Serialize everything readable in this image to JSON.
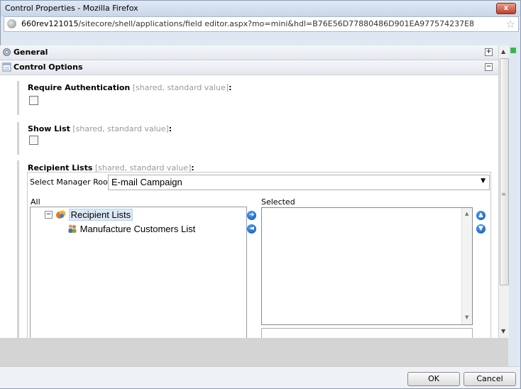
{
  "window": {
    "title": "Control Properties - Mozilla Firefox",
    "close_label": "x"
  },
  "urlbar": {
    "host": "660rev121015",
    "path": "/sitecore/shell/applications/field editor.aspx?mo=mini&hdl=B76E56D77880486D901EA977574237E8"
  },
  "sections": {
    "general": {
      "label": "General",
      "toggle": "+"
    },
    "control_options": {
      "label": "Control Options",
      "toggle": "−"
    }
  },
  "fields": {
    "require_auth": {
      "label": "Require Authentication",
      "meta": "[shared, standard value]",
      "colon": ":"
    },
    "show_list": {
      "label": "Show List",
      "meta": "[shared, standard value]",
      "colon": ":"
    },
    "recipient_lists": {
      "label": "Recipient Lists",
      "meta": "[shared, standard value]",
      "colon": ":"
    }
  },
  "recipient_editor": {
    "root_label": "Select Manager Root:",
    "root_value": "E-mail Campaign",
    "all_label": "All",
    "selected_label": "Selected",
    "tree": {
      "root_toggle": "−",
      "root_node": "Recipient Lists",
      "child_node": "Manufacture Customers List"
    }
  },
  "buttons": {
    "ok": "OK",
    "cancel": "Cancel"
  },
  "colors": {
    "accent_blue": "#0b4fb0",
    "selection_bg": "#dbe9f7",
    "status_green": "#3ab54a"
  }
}
